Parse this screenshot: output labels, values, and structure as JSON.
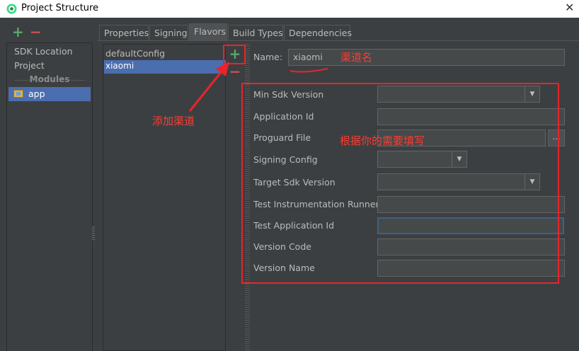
{
  "window": {
    "title": "Project Structure",
    "close_glyph": "✕",
    "app_icon": "android-studio-icon"
  },
  "sidebar": {
    "add_glyph": "+",
    "remove_glyph": "−",
    "items": [
      "SDK Location",
      "Project"
    ],
    "modules_header": "Modules",
    "modules": [
      {
        "label": "app",
        "selected": true,
        "icon": "folder-module-icon"
      }
    ]
  },
  "tabs": [
    {
      "label": "Properties",
      "active": false
    },
    {
      "label": "Signing",
      "active": false
    },
    {
      "label": "Flavors",
      "active": true
    },
    {
      "label": "Build Types",
      "active": false
    },
    {
      "label": "Dependencies",
      "active": false
    }
  ],
  "flavors": {
    "items": [
      "defaultConfig",
      "xiaomi"
    ],
    "selected": "xiaomi",
    "add_glyph": "+",
    "remove_glyph": "−"
  },
  "form": {
    "name_label": "Name:",
    "name_value": "xiaomi",
    "min_sdk_label": "Min Sdk Version",
    "min_sdk_value": "",
    "app_id_label": "Application Id",
    "app_id_value": "",
    "proguard_label": "Proguard File",
    "proguard_value": "",
    "proguard_browse": "...",
    "signing_label": "Signing Config",
    "signing_value": "",
    "target_sdk_label": "Target Sdk Version",
    "target_sdk_value": "",
    "test_runner_label": "Test Instrumentation Runner",
    "test_runner_value": "",
    "test_app_id_label": "Test Application Id",
    "test_app_id_value": "",
    "version_code_label": "Version Code",
    "version_code_value": "",
    "version_name_label": "Version Name",
    "version_name_value": "",
    "combo_arrow": "▼"
  },
  "annotations": {
    "channel_name": "渠道名",
    "add_channel": "添加渠道",
    "fill_as_needed": "根据你的需要填写",
    "color": "#e8242b"
  },
  "colors": {
    "background": "#3c3f41",
    "selection": "#4b6eaf",
    "add_green": "#59a869",
    "remove_red": "#c75450"
  }
}
